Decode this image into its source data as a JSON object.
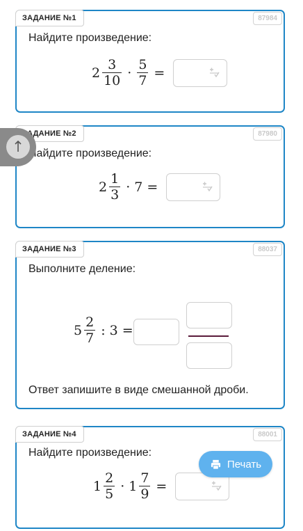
{
  "tasks": [
    {
      "title": "ЗАДАНИЕ №1",
      "id": "87984",
      "prompt": "Найдите произведение:",
      "expr": {
        "w1": "2",
        "n1": "3",
        "d1": "10",
        "op": "·",
        "n2": "5",
        "d2": "7",
        "eq": "="
      }
    },
    {
      "title": "ЗАДАНИЕ №2",
      "id": "87980",
      "prompt": "Найдите произведение:",
      "expr": {
        "w1": "2",
        "n1": "1",
        "d1": "3",
        "op": "·",
        "n2": "7",
        "eq": "="
      }
    },
    {
      "title": "ЗАДАНИЕ №3",
      "id": "88037",
      "prompt": "Выполните деление:",
      "note": "Ответ запишите в виде смешанной дроби.",
      "expr": {
        "w1": "5",
        "n1": "2",
        "d1": "7",
        "op": ":",
        "n2": "3",
        "eq": "="
      }
    },
    {
      "title": "ЗАДАНИЕ №4",
      "id": "88001",
      "prompt": "Найдите произведение:",
      "expr": {
        "w1": "1",
        "n1": "2",
        "d1": "5",
        "op": "·",
        "w2": "1",
        "n2": "7",
        "d2": "9",
        "eq": "="
      }
    }
  ],
  "print_button": {
    "label": "Печать",
    "icon": "printer-icon"
  },
  "side_tab": {
    "icon": "pointer-icon"
  },
  "colors": {
    "card_border": "#1e86c6",
    "print_button": "#5fb2ee"
  }
}
